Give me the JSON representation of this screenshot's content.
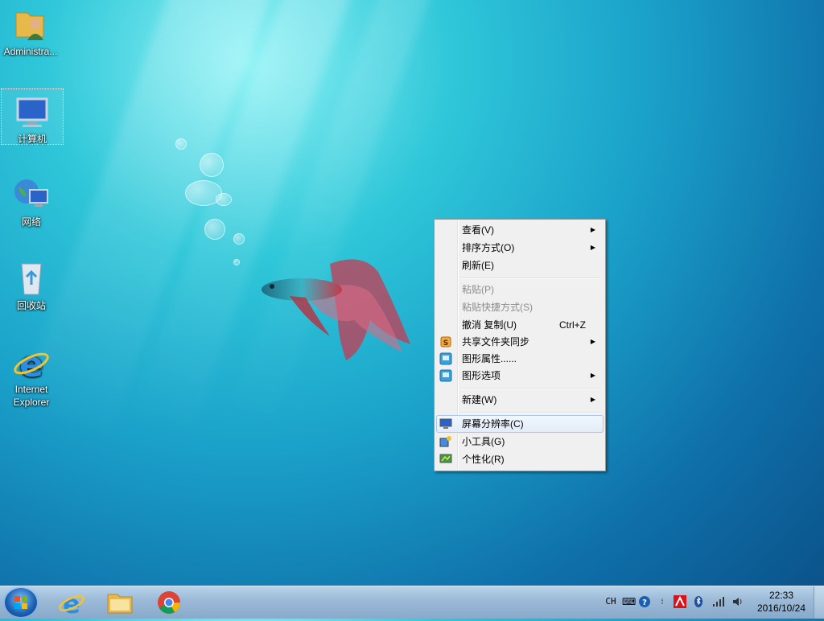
{
  "desktop": {
    "icons": [
      {
        "label": "Administra..."
      },
      {
        "label": "计算机"
      },
      {
        "label": "网络"
      },
      {
        "label": "回收站"
      },
      {
        "label": "Internet Explorer"
      }
    ]
  },
  "context_menu": {
    "items": [
      {
        "label": "查看(V)",
        "submenu": true
      },
      {
        "label": "排序方式(O)",
        "submenu": true
      },
      {
        "label": "刷新(E)"
      },
      {
        "label": "粘贴(P)",
        "disabled": true
      },
      {
        "label": "粘贴快捷方式(S)",
        "disabled": true
      },
      {
        "label": "撤消 复制(U)",
        "shortcut": "Ctrl+Z"
      },
      {
        "label": "共享文件夹同步",
        "submenu": true,
        "icon": "sync-s-icon"
      },
      {
        "label": "图形属性......",
        "icon": "graphics-icon"
      },
      {
        "label": "图形选项",
        "submenu": true,
        "icon": "graphics-options-icon"
      },
      {
        "label": "新建(W)",
        "submenu": true
      },
      {
        "label": "屏幕分辨率(C)",
        "icon": "monitor-icon",
        "highlighted": true
      },
      {
        "label": "小工具(G)",
        "icon": "gadgets-icon"
      },
      {
        "label": "个性化(R)",
        "icon": "personalize-icon"
      }
    ]
  },
  "taskbar": {
    "pinned": [
      "internet-explorer-icon",
      "file-explorer-icon",
      "chrome-icon"
    ],
    "tray": {
      "lang": "CH",
      "time": "22:33",
      "date": "2016/10/24"
    }
  },
  "colors": {
    "menu_bg": "#f0f0f0",
    "highlight_border": "#a8c8ec",
    "taskbar": "#9dbbd8"
  }
}
